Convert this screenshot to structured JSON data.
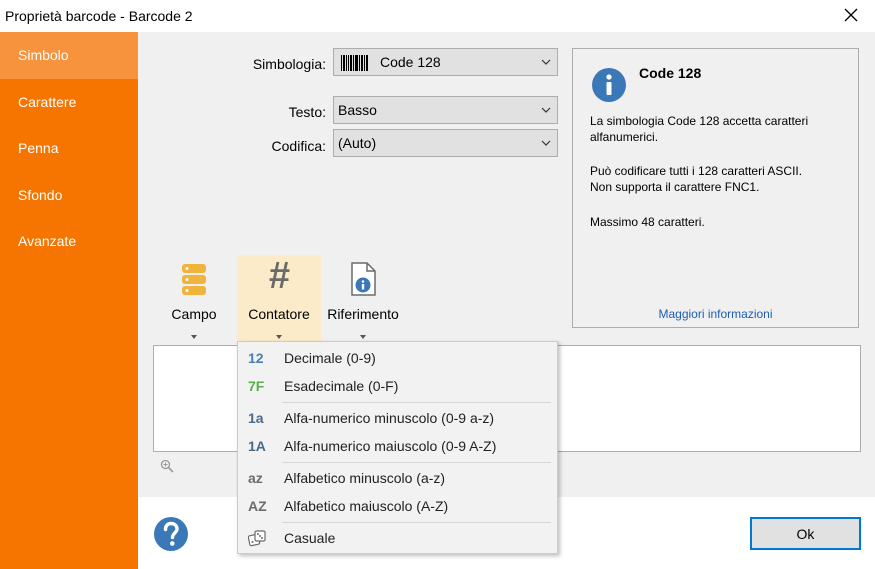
{
  "window": {
    "title": "Proprietà barcode - Barcode 2",
    "close_icon": "close-icon"
  },
  "sidebar": {
    "items": [
      {
        "label": "Simbolo",
        "active": true
      },
      {
        "label": "Carattere",
        "active": false
      },
      {
        "label": "Penna",
        "active": false
      },
      {
        "label": "Sfondo",
        "active": false
      },
      {
        "label": "Avanzate",
        "active": false
      }
    ]
  },
  "form": {
    "symbology_label": "Simbologia:",
    "symbology_value": "Code 128",
    "text_label": "Testo:",
    "text_value": "Basso",
    "encoding_label": "Codifica:",
    "encoding_value": "(Auto)"
  },
  "info": {
    "icon": "info-icon",
    "heading": "Code 128",
    "para1": "La simbologia Code 128 accetta caratteri alfanumerici.",
    "para2_line1": "Può codificare tutti i 128 caratteri ASCII.",
    "para2_line2": "Non supporta il carattere FNC1.",
    "para3": "Massimo 48 caratteri.",
    "more_link": "Maggiori informazioni"
  },
  "toolbar": {
    "field_label": "Campo",
    "counter_label": "Contatore",
    "reference_label": "Riferimento",
    "counter_symbol": "#"
  },
  "menu": {
    "items": [
      {
        "glyph": "12",
        "label": "Decimale (0-9)",
        "color": "#4a7fb5"
      },
      {
        "glyph": "7F",
        "label": "Esadecimale (0-F)",
        "color": "#5cad4f"
      },
      {
        "glyph": "1a",
        "label": "Alfa-numerico minuscolo (0-9 a-z)",
        "color": "#4a6a8a"
      },
      {
        "glyph": "1A",
        "label": "Alfa-numerico maiuscolo (0-9 A-Z)",
        "color": "#4a6a8a"
      },
      {
        "glyph": "az",
        "label": "Alfabetico minuscolo (a-z)",
        "color": "#6b6b6b"
      },
      {
        "glyph": "AZ",
        "label": "Alfabetico maiuscolo (A-Z)",
        "color": "#6b6b6b"
      },
      {
        "glyph": "",
        "label": "Casuale",
        "color": "#6b6b6b"
      }
    ]
  },
  "footer": {
    "ok_label": "Ok",
    "help_icon": "help-icon"
  },
  "colors": {
    "accent": "#f57500",
    "accent_active": "#f7923d",
    "highlight": "#fcebc9",
    "link": "#1a5fb4",
    "info_blue": "#3a78b8"
  }
}
